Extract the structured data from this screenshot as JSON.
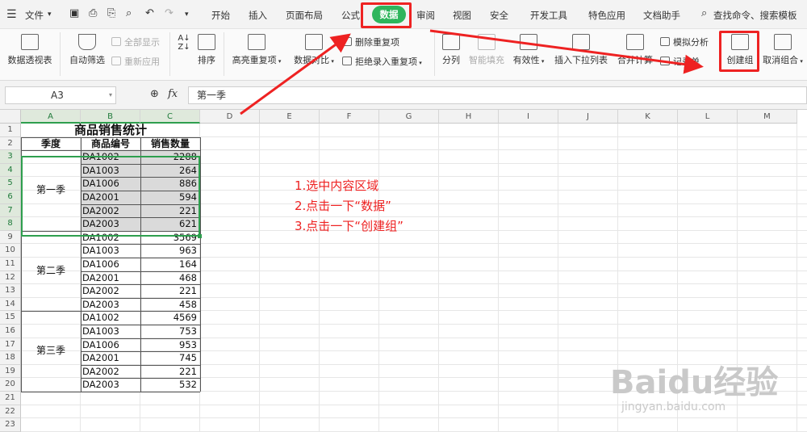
{
  "menubar": {
    "file_menu": "文件",
    "tabs": [
      "开始",
      "插入",
      "页面布局",
      "公式",
      "数据",
      "审阅",
      "视图",
      "安全",
      "开发工具",
      "特色应用",
      "文档助手"
    ],
    "search": "查找命令、搜索模板"
  },
  "ribbon": {
    "pivot": "数据透视表",
    "autofilter": "自动筛选",
    "show_all": "全部显示",
    "reapply": "重新应用",
    "sort": "排序",
    "highlight_dup": "高亮重复项",
    "compare": "数据对比",
    "remove_dup": "删除重复项",
    "reject_dup": "拒绝录入重复项",
    "split": "分列",
    "smart_fill": "智能填充",
    "validity": "有效性",
    "insert_dropdown": "插入下拉列表",
    "merge_calc": "合并计算",
    "simulate": "模拟分析",
    "record_list": "记录单",
    "create_group": "创建组",
    "ungroup": "取消组合"
  },
  "formula": {
    "cell_ref": "A3",
    "fx": "fx",
    "content": "第一季"
  },
  "columns": [
    "A",
    "B",
    "C",
    "D",
    "E",
    "F",
    "G",
    "H",
    "I",
    "J",
    "K",
    "L",
    "M"
  ],
  "rows": [
    "1",
    "2",
    "3",
    "4",
    "5",
    "6",
    "7",
    "8",
    "9",
    "10",
    "11",
    "12",
    "13",
    "14",
    "15",
    "16",
    "17",
    "18",
    "19",
    "20",
    "21",
    "22",
    "23"
  ],
  "sheet": {
    "title": "商品销售统计",
    "headers": [
      "季度",
      "商品编号",
      "销售数量"
    ],
    "groups": [
      {
        "season": "第一季",
        "items": [
          [
            "DA1002",
            "2288"
          ],
          [
            "DA1003",
            "264"
          ],
          [
            "DA1006",
            "886"
          ],
          [
            "DA2001",
            "594"
          ],
          [
            "DA2002",
            "221"
          ],
          [
            "DA2003",
            "621"
          ]
        ]
      },
      {
        "season": "第二季",
        "items": [
          [
            "DA1002",
            "3569"
          ],
          [
            "DA1003",
            "963"
          ],
          [
            "DA1006",
            "164"
          ],
          [
            "DA2001",
            "468"
          ],
          [
            "DA2002",
            "221"
          ],
          [
            "DA2003",
            "458"
          ]
        ]
      },
      {
        "season": "第三季",
        "items": [
          [
            "DA1002",
            "4569"
          ],
          [
            "DA1003",
            "753"
          ],
          [
            "DA1006",
            "953"
          ],
          [
            "DA2001",
            "745"
          ],
          [
            "DA2002",
            "221"
          ],
          [
            "DA2003",
            "532"
          ]
        ]
      }
    ]
  },
  "annotations": [
    "1.选中内容区域",
    "2.点击一下“数据”",
    "3.点击一下“创建组”"
  ],
  "watermark": {
    "brand": "Baidu经验",
    "url": "jingyan.baidu.com"
  },
  "colors": {
    "accent": "#2eb55c",
    "annotation": "#ee2222",
    "selection_border": "#2e9f4e"
  }
}
